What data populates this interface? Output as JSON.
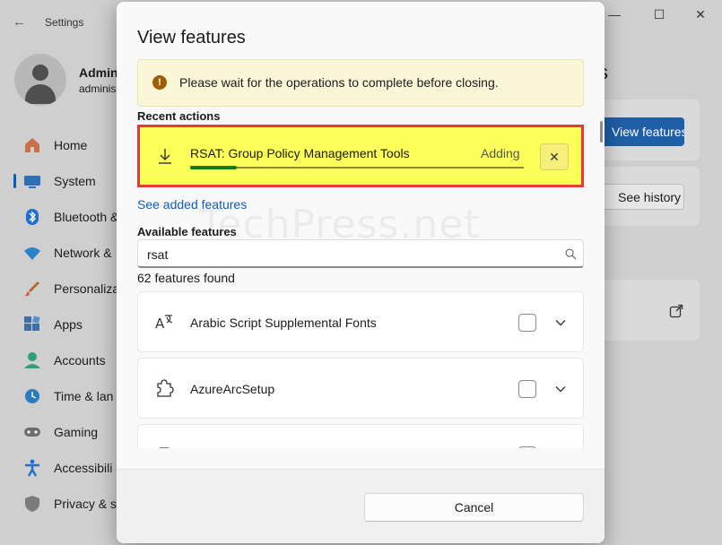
{
  "background_app": {
    "title": "Settings",
    "profile": {
      "name": "Admin",
      "email": "adminis"
    },
    "nav": [
      {
        "label": "Home",
        "icon": "home-icon"
      },
      {
        "label": "System",
        "icon": "system-icon",
        "active": true
      },
      {
        "label": "Bluetooth &",
        "icon": "bluetooth-icon"
      },
      {
        "label": "Network &",
        "icon": "network-icon"
      },
      {
        "label": "Personaliza",
        "icon": "personalization-icon"
      },
      {
        "label": "Apps",
        "icon": "apps-icon"
      },
      {
        "label": "Accounts",
        "icon": "accounts-icon"
      },
      {
        "label": "Time & lan",
        "icon": "time-language-icon"
      },
      {
        "label": "Gaming",
        "icon": "gaming-icon"
      },
      {
        "label": "Accessibili",
        "icon": "accessibility-icon"
      },
      {
        "label": "Privacy & s",
        "icon": "privacy-security-icon"
      }
    ],
    "right_heading_fragment": "s",
    "primary_button": "View features",
    "secondary_button": "See history"
  },
  "dialog": {
    "title": "View features",
    "info_message": "Please wait for the operations to complete before closing.",
    "recent_actions_label": "Recent actions",
    "recent_actions": [
      {
        "name": "RSAT: Group Policy Management Tools",
        "status": "Adding",
        "progress": 0.14
      }
    ],
    "see_added_link": "See added features",
    "available_label": "Available features",
    "search": {
      "value": "rsat",
      "placeholder": ""
    },
    "results_count": "62 features found",
    "features": [
      {
        "name": "Arabic Script Supplemental Fonts",
        "icon": "font-icon",
        "checked": false
      },
      {
        "name": "AzureArcSetup",
        "icon": "puzzle-icon",
        "checked": false
      },
      {
        "name": "",
        "icon": "feature-icon",
        "checked": false
      }
    ],
    "cancel_label": "Cancel"
  },
  "watermark": "TechPress.net",
  "colors": {
    "accent": "#005fb8",
    "highlight": "#ffff5a",
    "highlight_border": "#e33b3b",
    "progress": "#0f7b0f",
    "info": "#9d5d00"
  }
}
